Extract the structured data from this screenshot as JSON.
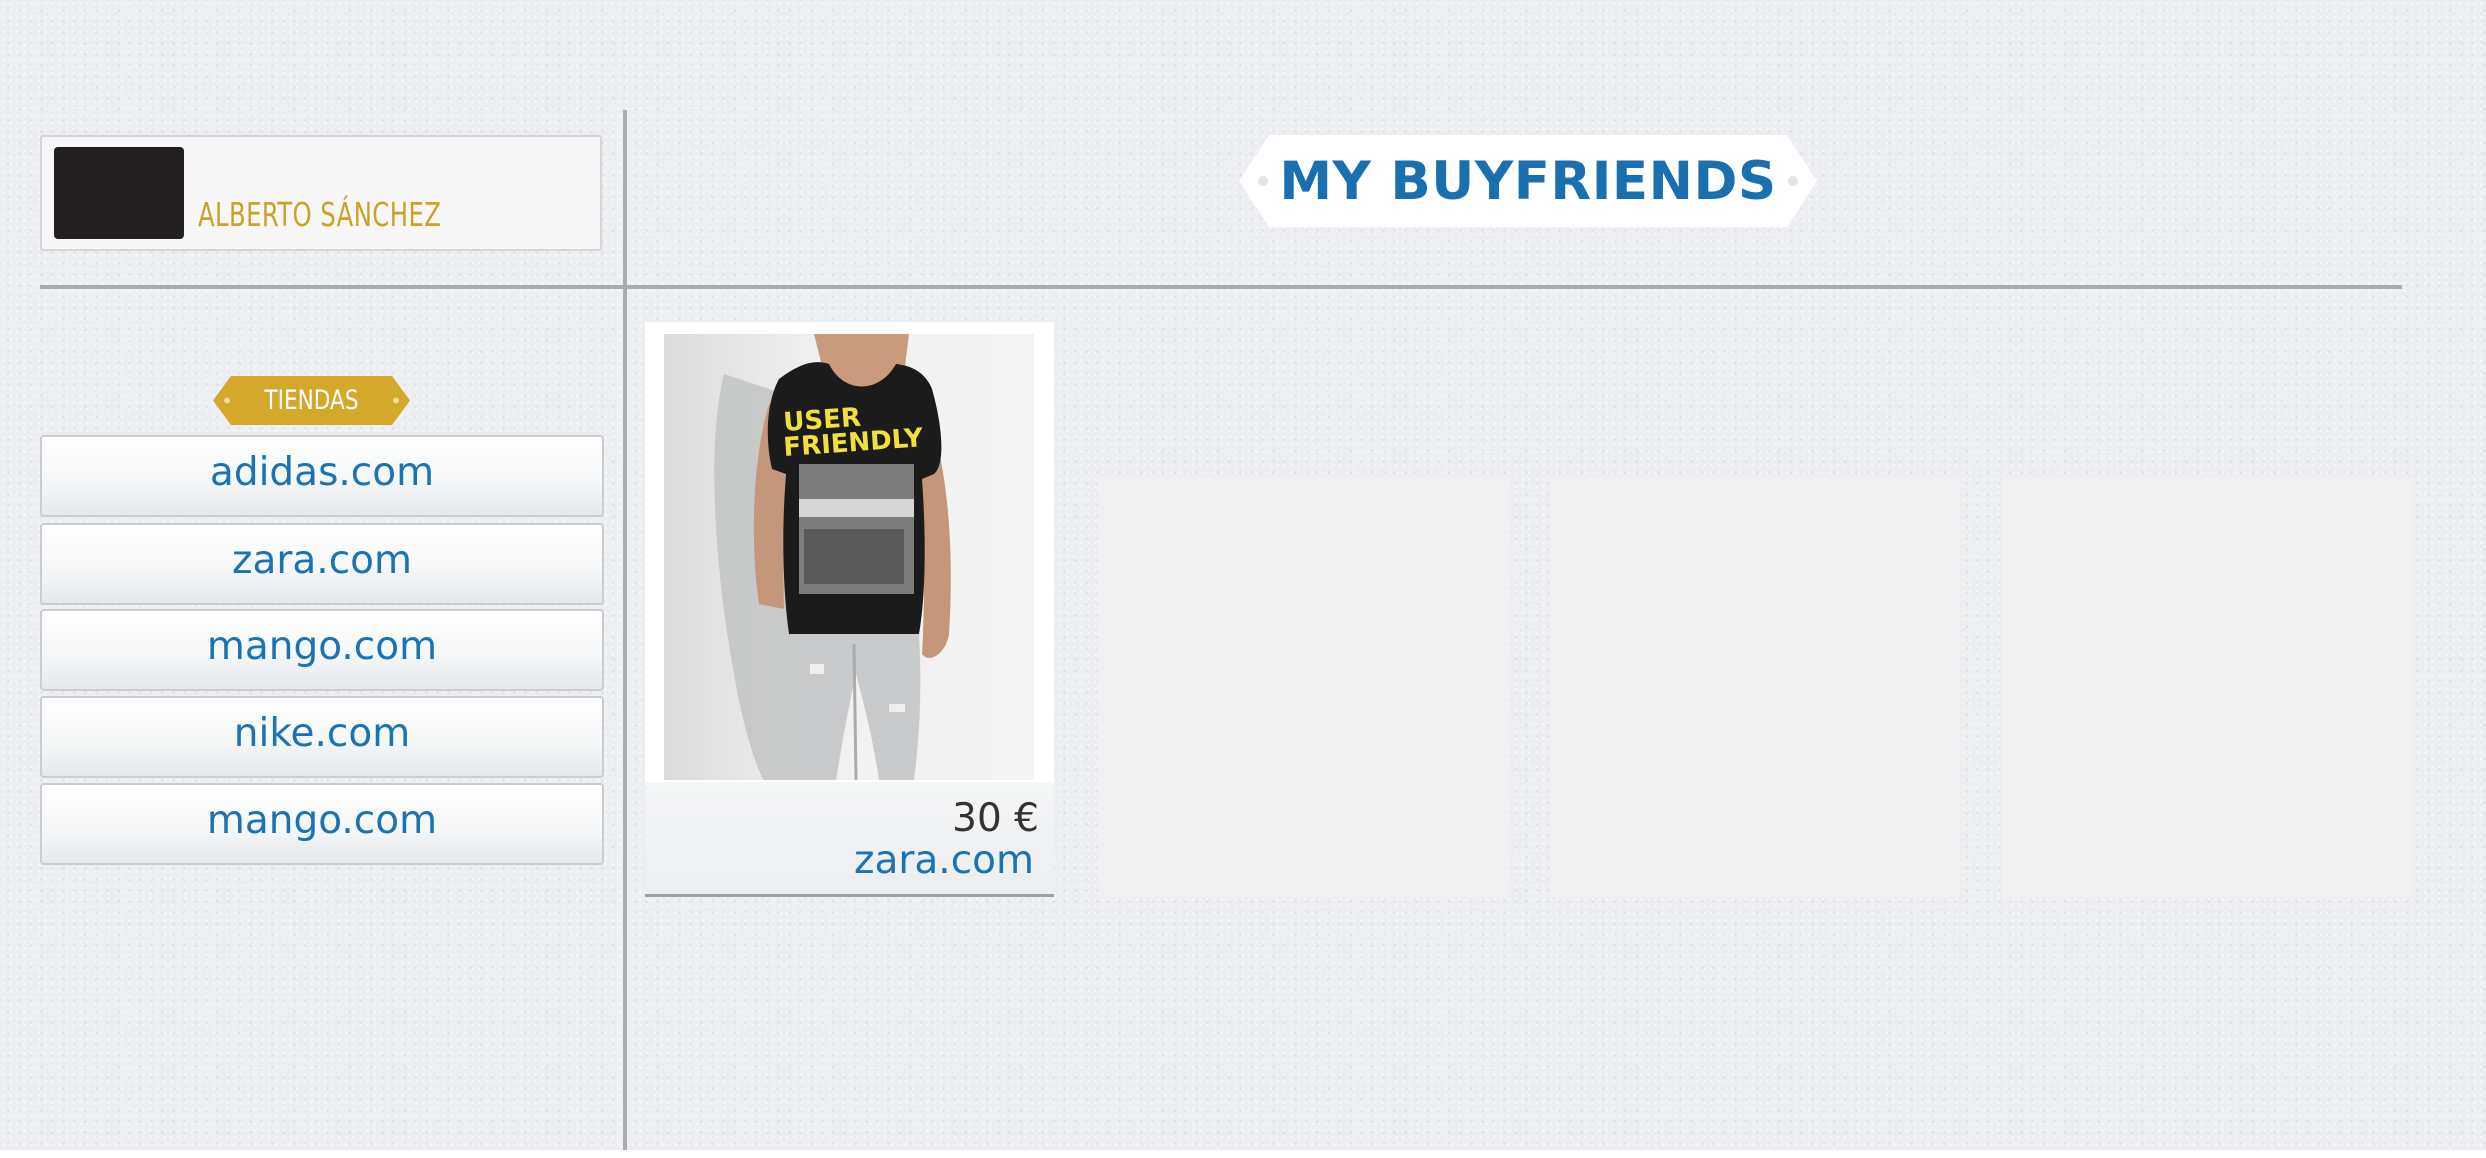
{
  "profile": {
    "name": "ALBERTO SÁNCHEZ"
  },
  "header": {
    "title": "MY BUYFRIENDS"
  },
  "sidebar": {
    "section_label": "TIENDAS",
    "stores": [
      {
        "label": "adidas.com"
      },
      {
        "label": "zara.com"
      },
      {
        "label": "mango.com"
      },
      {
        "label": "nike.com"
      },
      {
        "label": "mango.com"
      }
    ]
  },
  "products": [
    {
      "image": "t-shirt-model-photo",
      "shirt_text": [
        "USER",
        "FRIENDLY"
      ],
      "price": "30 €",
      "store": "zara.com"
    }
  ],
  "colors": {
    "accent_blue": "#1a73b5",
    "gold": "#c9a227",
    "background": "#eceef1"
  }
}
